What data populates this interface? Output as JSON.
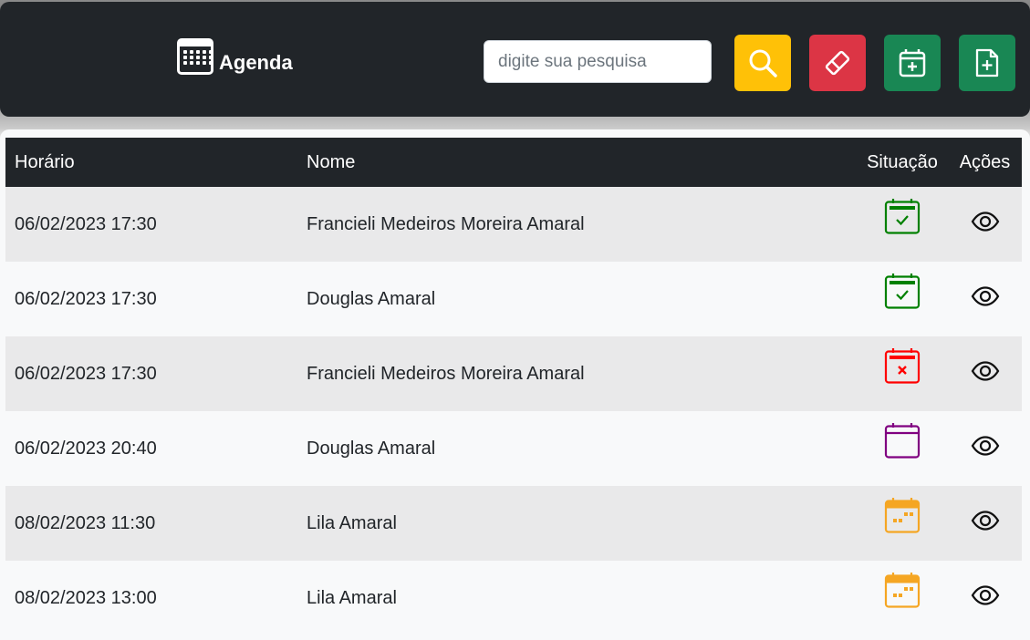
{
  "header": {
    "brand_icon": "calendar-grid-icon",
    "brand": "Agenda",
    "search_placeholder": "digite sua pesquisa",
    "buttons": [
      {
        "icon": "search-icon",
        "color": "#ffc107"
      },
      {
        "icon": "eraser-icon",
        "color": "#dc3545"
      },
      {
        "icon": "calendar-plus-icon",
        "color": "#198754"
      },
      {
        "icon": "file-plus-icon",
        "color": "#198754"
      }
    ]
  },
  "table": {
    "columns": {
      "horario": "Horário",
      "nome": "Nome",
      "situacao": "Situação",
      "acoes": "Ações"
    },
    "rows": [
      {
        "horario": "06/02/2023 17:30",
        "nome": "Francieli Medeiros Moreira Amaral",
        "status_icon": "calendar-check-icon",
        "status_color": "#008000",
        "action_icon": "eye-icon"
      },
      {
        "horario": "06/02/2023 17:30",
        "nome": "Douglas Amaral",
        "status_icon": "calendar-check-icon",
        "status_color": "#008000",
        "action_icon": "eye-icon"
      },
      {
        "horario": "06/02/2023 17:30",
        "nome": "Francieli Medeiros Moreira Amaral",
        "status_icon": "calendar-x-icon",
        "status_color": "#ff0000",
        "action_icon": "eye-icon"
      },
      {
        "horario": "06/02/2023 20:40",
        "nome": "Douglas Amaral",
        "status_icon": "calendar-empty-icon",
        "status_color": "#800080",
        "action_icon": "eye-icon"
      },
      {
        "horario": "08/02/2023 11:30",
        "nome": "Lila Amaral",
        "status_icon": "calendar-dots-icon",
        "status_color": "#f5a623",
        "action_icon": "eye-icon"
      },
      {
        "horario": "08/02/2023 13:00",
        "nome": "Lila Amaral",
        "status_icon": "calendar-dots-icon",
        "status_color": "#f5a623",
        "action_icon": "eye-icon"
      }
    ]
  }
}
